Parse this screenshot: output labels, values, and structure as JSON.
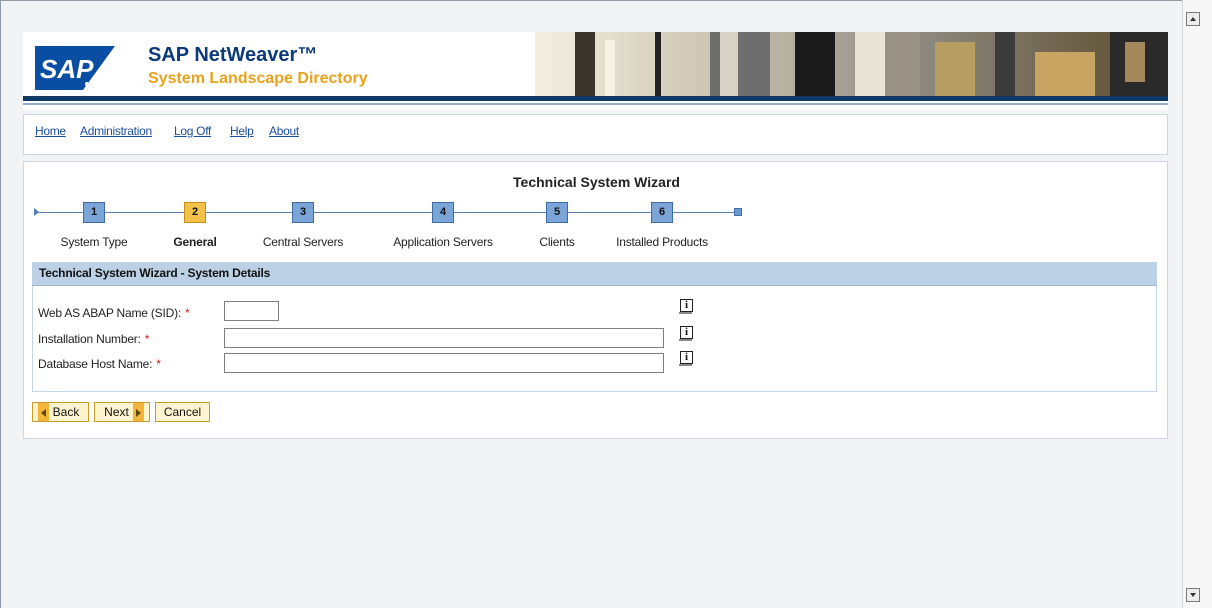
{
  "app": {
    "brand_title": "SAP NetWeaver™",
    "brand_subtitle": "System Landscape Directory",
    "logo_text": "SAP"
  },
  "nav": {
    "links": [
      "Home",
      "Administration",
      "Log Off",
      "Help",
      "About"
    ]
  },
  "wizard": {
    "title": "Technical System Wizard",
    "current_step": 2,
    "steps": [
      {
        "number": "1",
        "label": "System Type"
      },
      {
        "number": "2",
        "label": "General"
      },
      {
        "number": "3",
        "label": "Central Servers"
      },
      {
        "number": "4",
        "label": "Application Servers"
      },
      {
        "number": "5",
        "label": "Clients"
      },
      {
        "number": "6",
        "label": "Installed Products"
      }
    ]
  },
  "section": {
    "title": "Technical System Wizard - System Details"
  },
  "form": {
    "fields": [
      {
        "label": "Web AS ABAP Name (SID):",
        "required": "*",
        "value": ""
      },
      {
        "label": "Installation Number:",
        "required": "*",
        "value": ""
      },
      {
        "label": "Database Host Name:",
        "required": "*",
        "value": ""
      }
    ],
    "info_icon": "i"
  },
  "buttons": {
    "back": "Back",
    "next": "Next",
    "cancel": "Cancel"
  },
  "colors": {
    "accent": "#0f3a68",
    "brand_orange": "#e8a21c",
    "step_active": "#f2c14a",
    "step_inactive": "#7aa5d6",
    "required": "#d21e1e"
  }
}
